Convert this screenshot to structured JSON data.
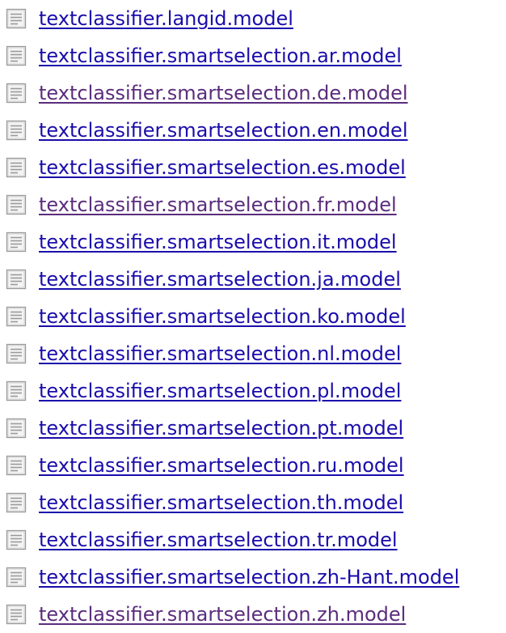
{
  "colors": {
    "link": "#1a0dab",
    "visited": "#5b2d7d"
  },
  "icon": "document-icon",
  "files": [
    {
      "label": "textclassifier.langid.model",
      "visited": false
    },
    {
      "label": "textclassifier.smartselection.ar.model",
      "visited": false
    },
    {
      "label": "textclassifier.smartselection.de.model",
      "visited": true
    },
    {
      "label": "textclassifier.smartselection.en.model",
      "visited": false
    },
    {
      "label": "textclassifier.smartselection.es.model",
      "visited": false
    },
    {
      "label": "textclassifier.smartselection.fr.model",
      "visited": true
    },
    {
      "label": "textclassifier.smartselection.it.model",
      "visited": false
    },
    {
      "label": "textclassifier.smartselection.ja.model",
      "visited": false
    },
    {
      "label": "textclassifier.smartselection.ko.model",
      "visited": false
    },
    {
      "label": "textclassifier.smartselection.nl.model",
      "visited": false
    },
    {
      "label": "textclassifier.smartselection.pl.model",
      "visited": false
    },
    {
      "label": "textclassifier.smartselection.pt.model",
      "visited": false
    },
    {
      "label": "textclassifier.smartselection.ru.model",
      "visited": false
    },
    {
      "label": "textclassifier.smartselection.th.model",
      "visited": false
    },
    {
      "label": "textclassifier.smartselection.tr.model",
      "visited": false
    },
    {
      "label": "textclassifier.smartselection.zh-Hant.model",
      "visited": false
    },
    {
      "label": "textclassifier.smartselection.zh.model",
      "visited": true
    }
  ]
}
